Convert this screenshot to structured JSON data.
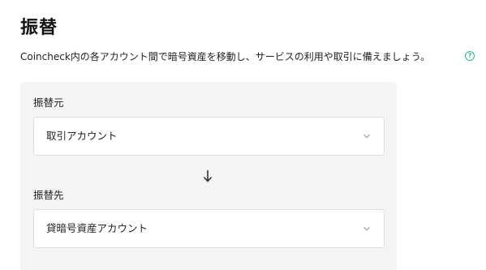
{
  "header": {
    "title": "振替",
    "description": "Coincheck内の各アカウント間で暗号資産を移動し、サービスの利用や取引に備えましょう。",
    "help_icon": "question-circle-icon",
    "help_glyph": "?"
  },
  "transfer": {
    "from": {
      "label": "振替元",
      "selected": "取引アカウント"
    },
    "direction_icon": "arrow-down-icon",
    "to": {
      "label": "振替先",
      "selected": "貸暗号資産アカウント"
    }
  },
  "colors": {
    "accent": "#35b88a",
    "panel_background": "#f3f4f6",
    "input_border": "#dcdee2"
  }
}
